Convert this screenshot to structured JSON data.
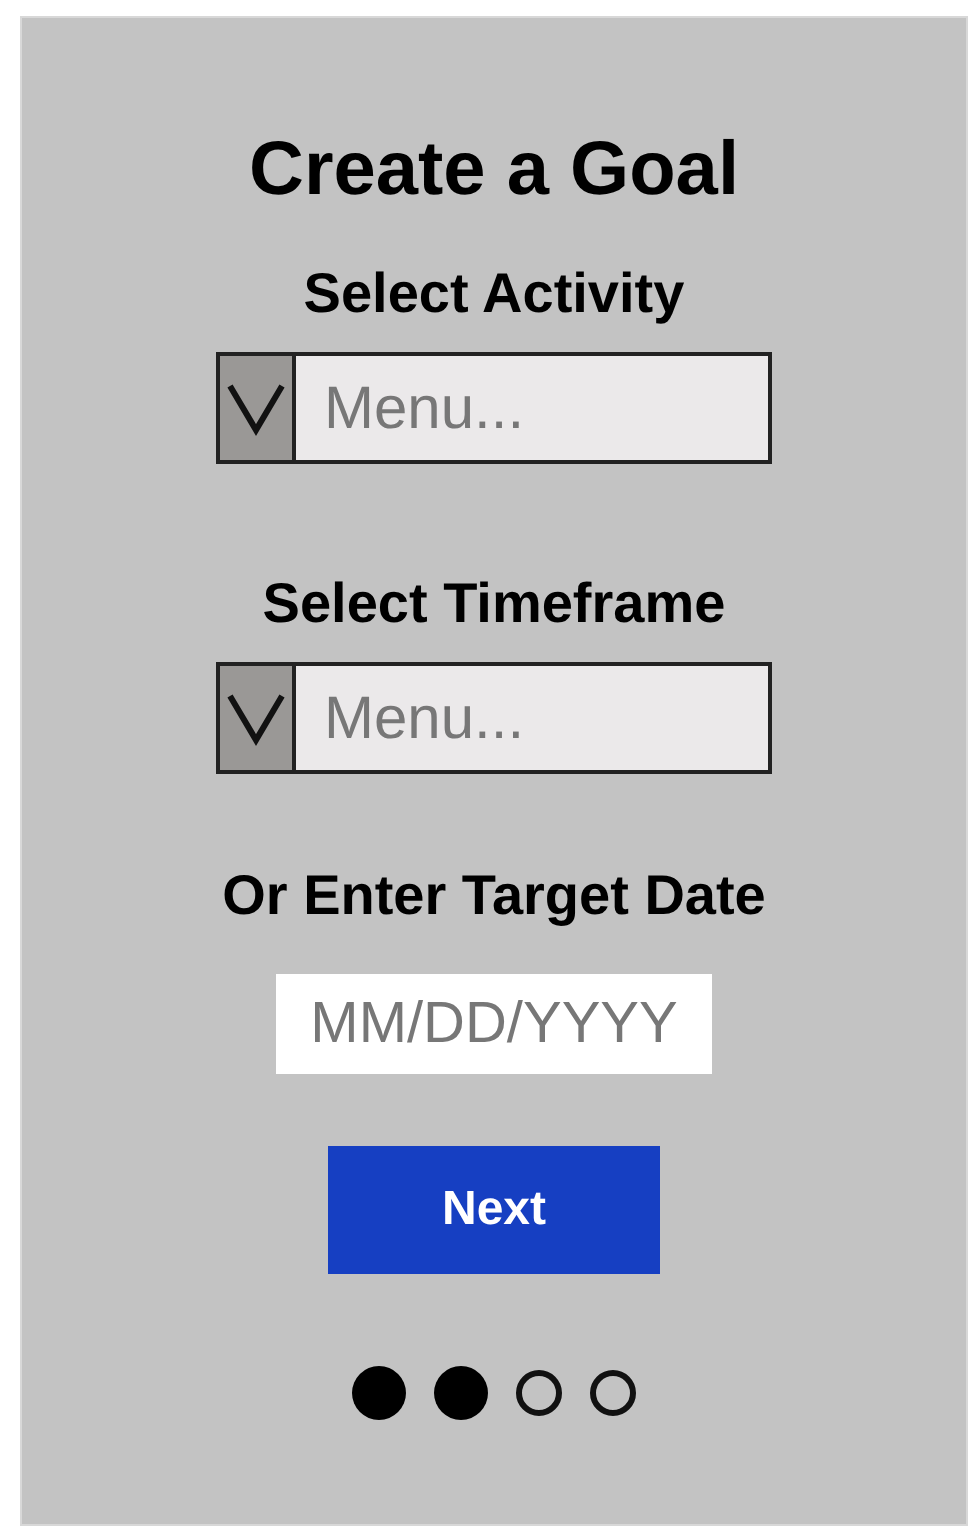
{
  "title": "Create a Goal",
  "selects": [
    {
      "label": "Select Activity",
      "placeholder": "Menu..."
    },
    {
      "label": "Select Timeframe",
      "placeholder": "Menu..."
    }
  ],
  "date": {
    "label": "Or Enter Target Date",
    "placeholder": "MM/DD/YYYY"
  },
  "next_button": "Next",
  "steps": [
    {
      "done": true
    },
    {
      "done": true
    },
    {
      "done": false
    },
    {
      "done": false
    }
  ]
}
